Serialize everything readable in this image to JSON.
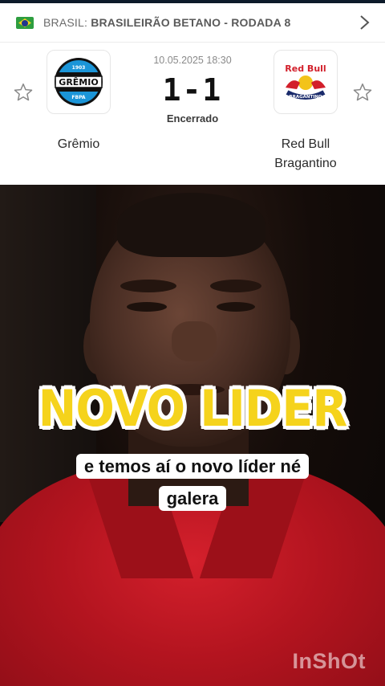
{
  "league": {
    "country": "BRASIL:",
    "name": "BRASILEIRÃO BETANO - RODADA 8"
  },
  "match": {
    "datetime": "10.05.2025 18:30",
    "score": "1-1",
    "status": "Encerrado",
    "home": {
      "name": "Grêmio",
      "logo_text_top": "1903",
      "logo_text": "GRÊMIO",
      "logo_text_bottom": "FBPA"
    },
    "away": {
      "name": "Red Bull Bragantino",
      "logo_text": "Red Bull",
      "logo_text_bottom": "BRAGANTINO"
    }
  },
  "video": {
    "headline": "NOVO LIDER",
    "caption_line1": "e temos aí o novo líder né",
    "caption_line2": "galera",
    "watermark": "InShOt"
  },
  "icons": {
    "favorite_home": "star-outline-icon",
    "favorite_away": "star-outline-icon",
    "league_flag": "brazil-flag-icon",
    "nav": "chevron-right-icon"
  },
  "colors": {
    "headline": "#f5d31c",
    "shirt": "#c4161f",
    "gremio_blue": "#1b95d8"
  }
}
